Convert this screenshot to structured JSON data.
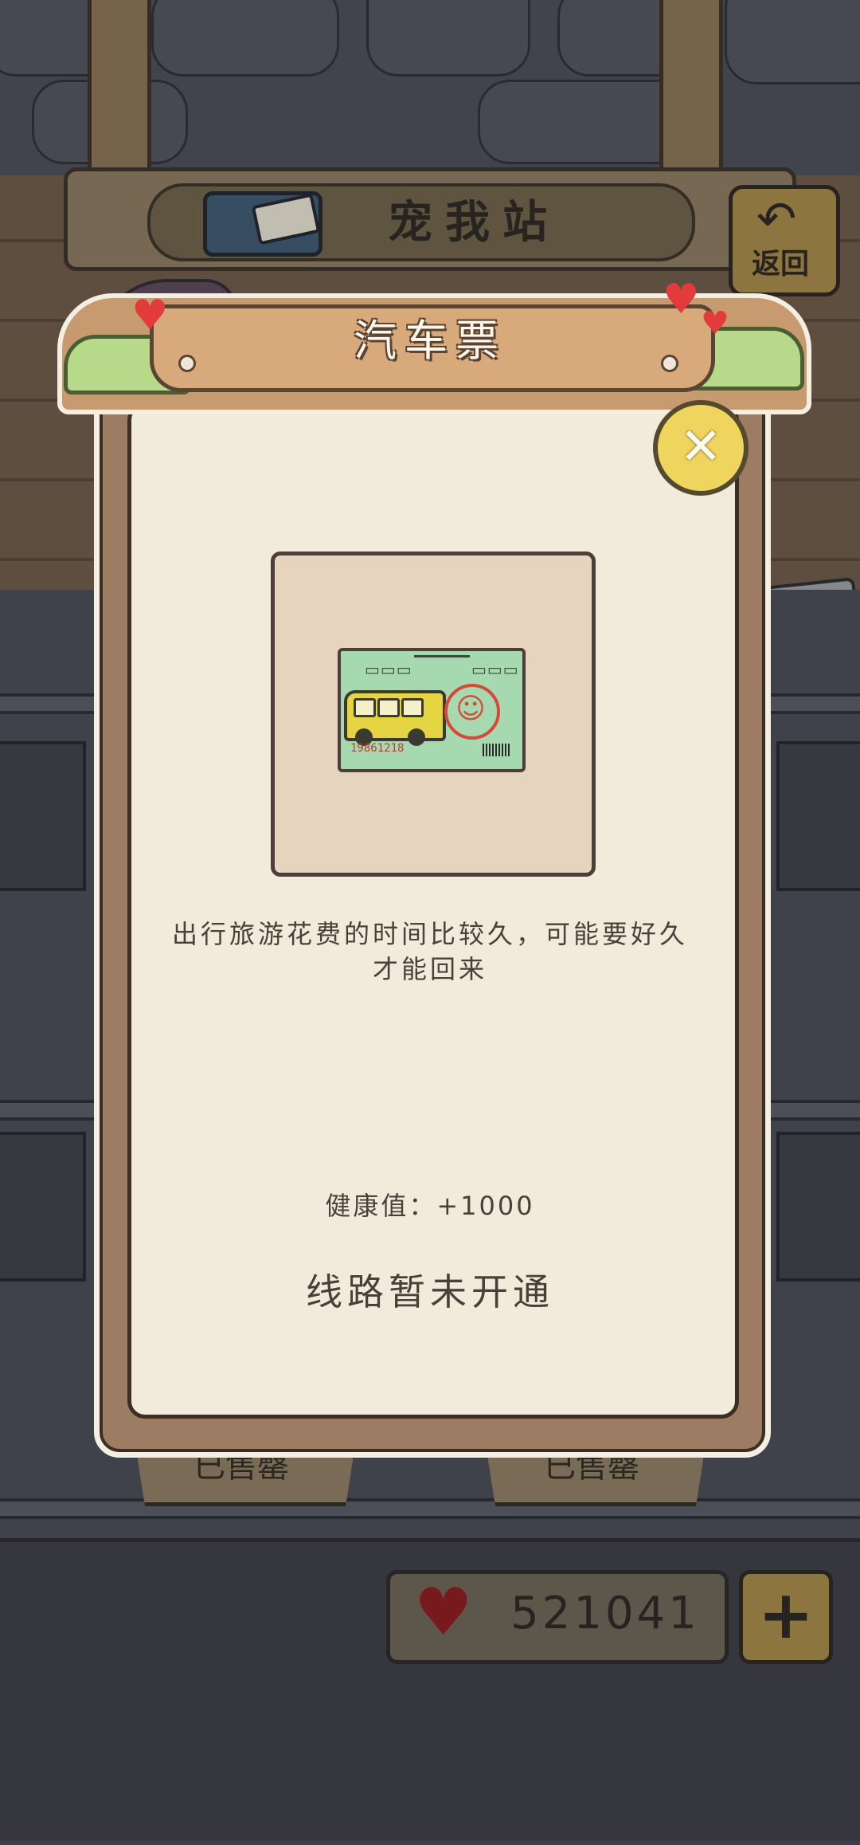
{
  "header": {
    "station_title": "宠我站",
    "back_label": "返回"
  },
  "shelf": {
    "sold_labels": [
      "已售罄",
      "已售罄"
    ]
  },
  "currency": {
    "hearts": "521041",
    "icon": "heart-icon"
  },
  "modal": {
    "title": "汽车票",
    "close_icon": "close-icon",
    "item": {
      "name": "bus-ticket",
      "ticket_code": "19861218"
    },
    "description": "出行旅游花费的时间比较久，可能要好久才能回来",
    "health": "健康值：+1000",
    "status": "线路暂未开通"
  },
  "colors": {
    "panel": "#f2ebdc",
    "frame": "#9c7c62",
    "close_button": "#efd55e",
    "heart": "#8e1a1e",
    "ticket": "#a6d9b0",
    "bus": "#e6d542"
  }
}
